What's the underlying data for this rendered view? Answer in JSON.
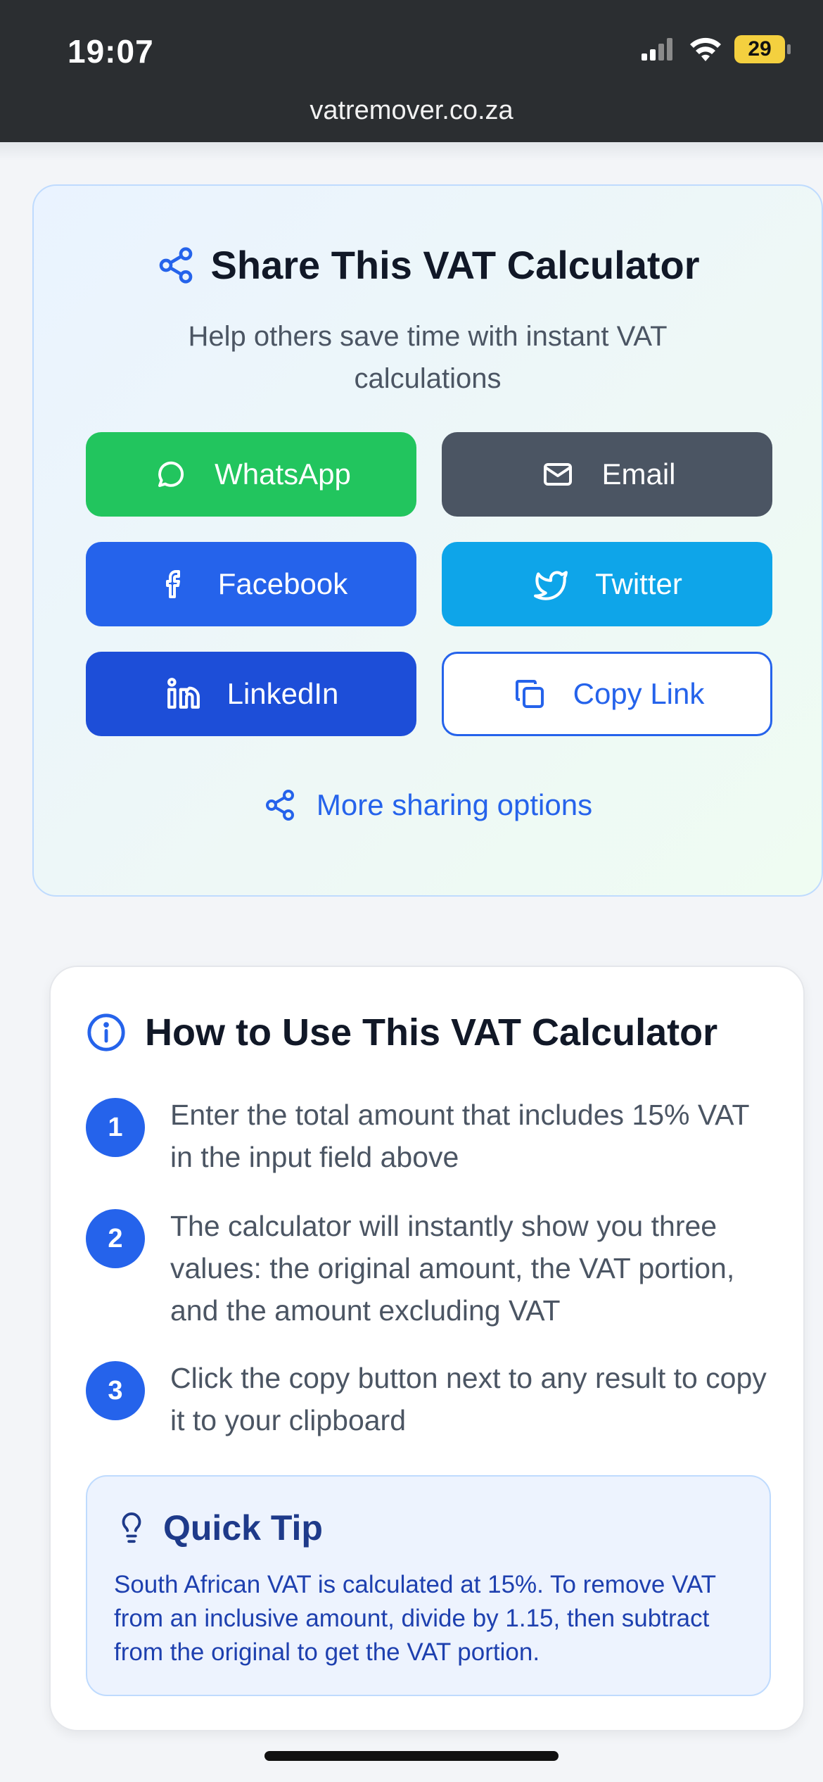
{
  "status_bar": {
    "time": "19:07",
    "battery": "29"
  },
  "browser": {
    "url": "vatremover.co.za"
  },
  "share": {
    "title": "Share This VAT Calculator",
    "subtitle": "Help others save time with instant VAT calculations",
    "buttons": {
      "whatsapp": "WhatsApp",
      "email": "Email",
      "facebook": "Facebook",
      "twitter": "Twitter",
      "linkedin": "LinkedIn",
      "copy_link": "Copy Link"
    },
    "more": "More sharing options"
  },
  "how_to": {
    "title": "How to Use This VAT Calculator",
    "steps": [
      {
        "num": "1",
        "text": "Enter the total amount that includes 15% VAT in the input field above"
      },
      {
        "num": "2",
        "text": "The calculator will instantly show you three values: the original amount, the VAT portion, and the amount excluding VAT"
      },
      {
        "num": "3",
        "text": "Click the copy button next to any result to copy it to your clipboard"
      }
    ],
    "tip": {
      "title": "Quick Tip",
      "text": "South African VAT is calculated at 15%. To remove VAT from an inclusive amount, divide by 1.15, then subtract from the original to get the VAT portion."
    }
  },
  "colors": {
    "whatsapp": "#22c55e",
    "email": "#4b5563",
    "facebook": "#2563eb",
    "twitter": "#0ea5e9",
    "linkedin": "#1d4ed8",
    "accent": "#2563eb"
  }
}
